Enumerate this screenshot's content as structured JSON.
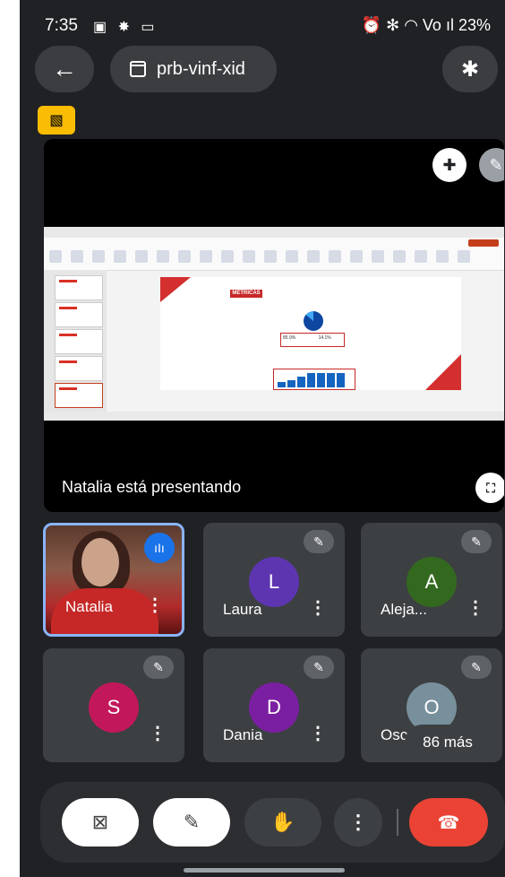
{
  "status_bar": {
    "time": "7:35",
    "left_icons": "▣ ✸ ▭",
    "right_icons": "⏰ ✻ ◠ Vo ıl",
    "battery": "23%"
  },
  "top_bar": {
    "back_icon": "arrow-left-icon",
    "meeting_code": "prb-vinf-xid",
    "bluetooth_icon": "bluetooth-icon"
  },
  "presentation": {
    "presenting_text": "Natalia está presentando",
    "slide_badge": "MÉTRICAS",
    "slide_stat_1": "85.9%",
    "slide_stat_2": "14.1%",
    "fullscreen_icon": "⛶"
  },
  "participants": [
    {
      "name": "Natalia",
      "initial": "",
      "color": "",
      "speaking": true
    },
    {
      "name": "Laura",
      "initial": "L",
      "color": "#5e35b1"
    },
    {
      "name": "Aleja...",
      "initial": "A",
      "color": "#33691e"
    },
    {
      "name": "",
      "initial": "S",
      "color": "#c2185b"
    },
    {
      "name": "Dania",
      "initial": "D",
      "color": "#7b1fa2"
    },
    {
      "name": "Osc",
      "initial": "O",
      "color": "#78909c"
    }
  ],
  "more_participants": "86 más",
  "controls": {
    "more_icon": "⋮"
  }
}
